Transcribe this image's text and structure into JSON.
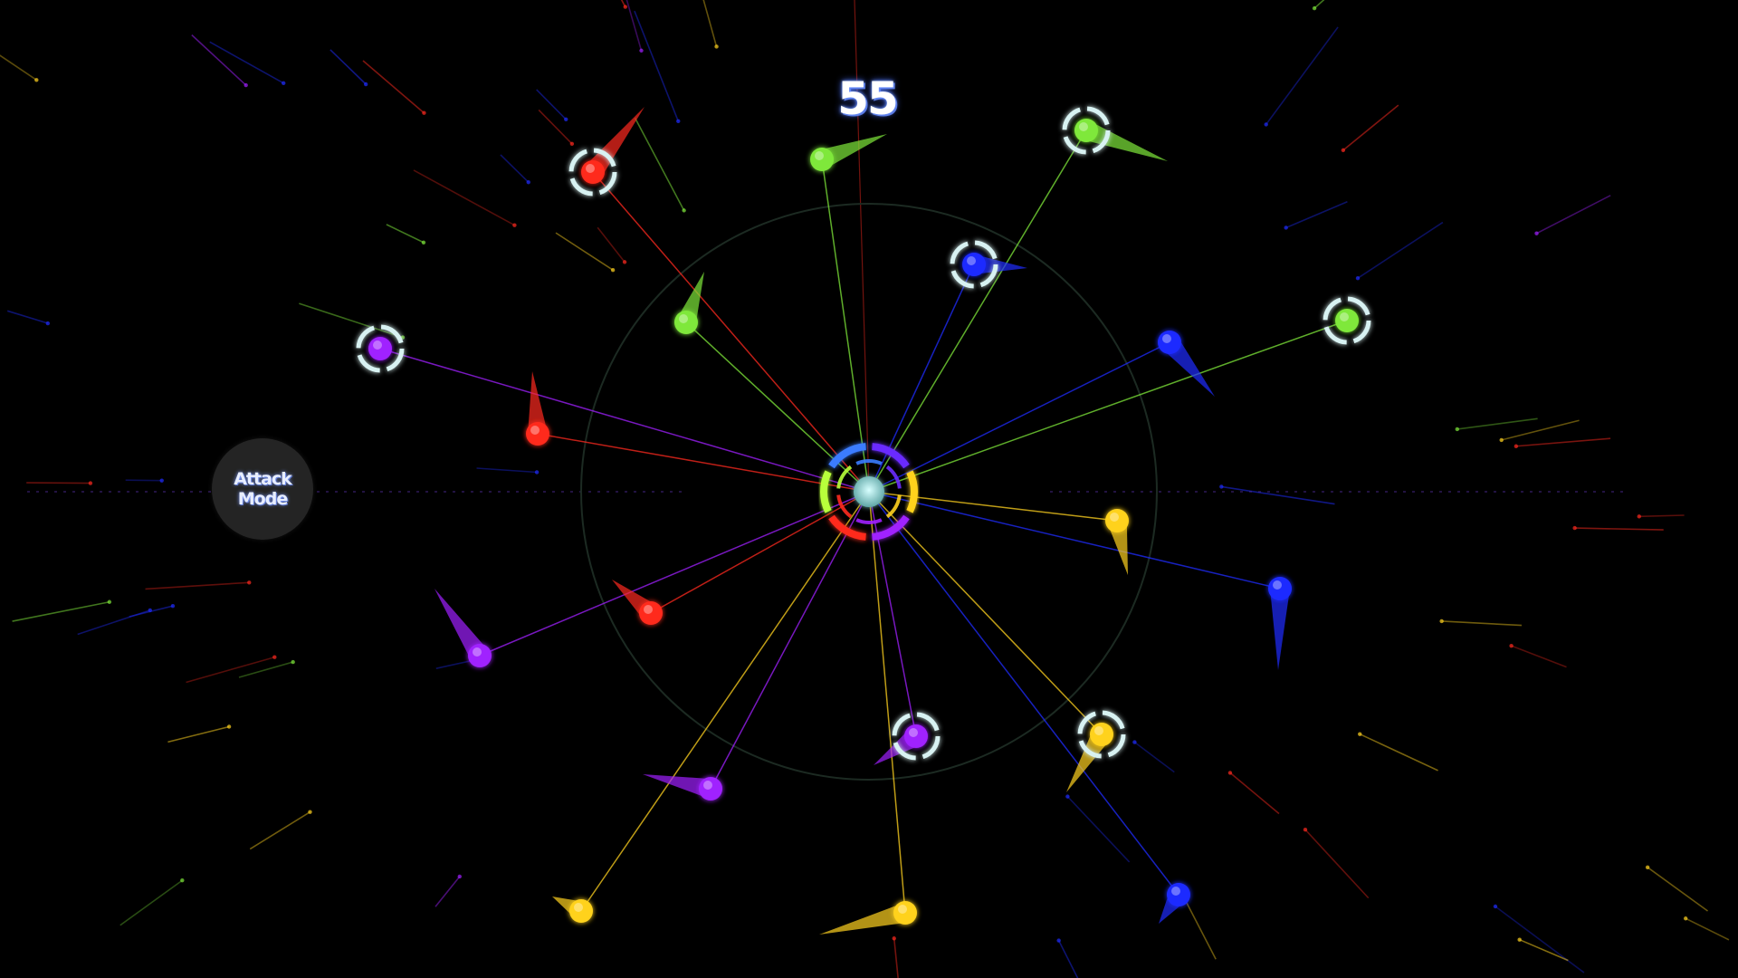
{
  "hud": {
    "score": "55",
    "attack_button_label": "Attack\nMode"
  },
  "colors": {
    "background": "#000000",
    "red": "#ff2a1f",
    "green": "#7fe83a",
    "blue": "#1f2cff",
    "purple": "#a020ff",
    "yellow": "#ffd21f",
    "ring": "#d8f2f2",
    "core": "#8fd6d6"
  },
  "core": {
    "arc_colors": [
      "#6a2cff",
      "#ffd21f",
      "#a020ff",
      "#ff2a1f",
      "#b8ff3a",
      "#3a7cff"
    ]
  },
  "orbs": [
    {
      "color": "red",
      "ringed": true,
      "trail": true
    },
    {
      "color": "green",
      "ringed": false,
      "trail": true
    },
    {
      "color": "green",
      "ringed": true,
      "trail": true
    },
    {
      "color": "blue",
      "ringed": true,
      "trail": true
    },
    {
      "color": "green",
      "ringed": true,
      "trail": false
    },
    {
      "color": "green",
      "ringed": false,
      "trail": true
    },
    {
      "color": "purple",
      "ringed": true,
      "trail": false
    },
    {
      "color": "red",
      "ringed": false,
      "trail": true
    },
    {
      "color": "blue",
      "ringed": false,
      "trail": true
    },
    {
      "color": "yellow",
      "ringed": false,
      "trail": true
    },
    {
      "color": "blue",
      "ringed": false,
      "trail": true
    },
    {
      "color": "red",
      "ringed": false,
      "trail": true
    },
    {
      "color": "purple",
      "ringed": false,
      "trail": true
    },
    {
      "color": "purple",
      "ringed": true,
      "trail": true
    },
    {
      "color": "yellow",
      "ringed": true,
      "trail": true
    },
    {
      "color": "purple",
      "ringed": false,
      "trail": true
    },
    {
      "color": "yellow",
      "ringed": false,
      "trail": true
    },
    {
      "color": "yellow",
      "ringed": false,
      "trail": true
    },
    {
      "color": "blue",
      "ringed": false,
      "trail": true
    }
  ]
}
